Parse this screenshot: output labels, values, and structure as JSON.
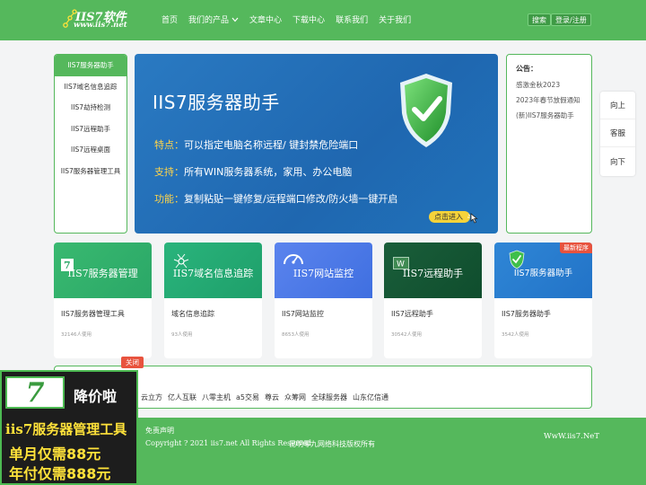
{
  "header": {
    "logo_brand": "IIS7软件",
    "logo_site": "www.iis7.net",
    "nav": [
      "首页",
      "我们的产品",
      "文章中心",
      "下载中心",
      "联系我们",
      "关于我们"
    ],
    "search_label": "搜索",
    "login_label": "登录/注册"
  },
  "leftmenu": {
    "items": [
      "IIS7服务器助手",
      "IIS7域名信息追踪",
      "IIS7劫持检测",
      "IIS7远程助手",
      "IIS7远程桌面",
      "IIS7服务器管理工具"
    ]
  },
  "banner": {
    "title": "IIS7服务器助手",
    "l1_key": "特点：",
    "l1_text": "可以指定电脑名称远程/   键封禁危险端口",
    "l2_key": "支持：",
    "l2_text": "所有WIN服务器系统，家用、办公电脑",
    "l3_key": "功能：",
    "l3_text": "复制粘贴一键修复/远程端口修改/防火墙一键开启",
    "cta": "点击进入"
  },
  "notice": {
    "title": "公告：",
    "items": [
      "感激金秋2023",
      "2023年春节放假通知",
      "(新)IIS7服务器助手"
    ]
  },
  "floatbar": {
    "up": "向上",
    "service": "客服",
    "down": "向下"
  },
  "cards": [
    {
      "thumb_title": "IIS7服务器管理",
      "name": "IIS7服务器管理工具",
      "uses": "32146人使用"
    },
    {
      "thumb_title": "IIS7域名信息追踪",
      "name": "域名信息追踪",
      "uses": "93人使用"
    },
    {
      "thumb_title": "IIS7网站监控",
      "name": "IIS7网站监控",
      "uses": "8653人使用"
    },
    {
      "thumb_title": "IIS7远程助手",
      "name": "IIS7远程助手",
      "uses": "30542人使用"
    },
    {
      "thumb_title": "IIS7服务器助手",
      "name": "IIS7服务器助手",
      "uses": "3542人使用",
      "tag": "最新程序"
    }
  ],
  "links": {
    "close_label": "关闭",
    "items": [
      "云立方",
      "亿人互联",
      "八零主机",
      "a5交易",
      "尊云",
      "众筹网",
      "全球服务器",
      "山东亿信通"
    ]
  },
  "footer": {
    "disclaimer": "免责声明",
    "copyright": "Copyright ? 2021 iis7.net All Rights Reserved.",
    "owner": "昆明零九网络科技版权所有",
    "site": "WwW.iis7.NeT"
  },
  "promo": {
    "logo_digit": "7",
    "headline": "降价啦",
    "product": "iis7服务器管理工具",
    "price_month": "单月仅需88元",
    "price_year": "年付仅需888元"
  },
  "colors": {
    "brand_green": "#55b85c",
    "banner_blue": "#1f67b0",
    "accent_yellow": "#ffd44a",
    "tag_red": "#e8533e"
  }
}
